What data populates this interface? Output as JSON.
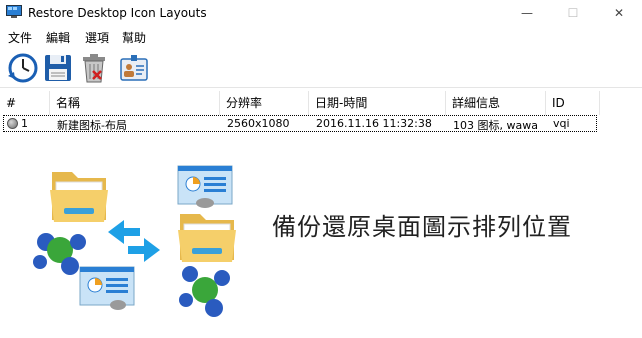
{
  "window": {
    "title": "Restore Desktop Icon Layouts",
    "minimize_glyph": "—",
    "maximize_glyph": "☐",
    "close_glyph": "✕"
  },
  "menu": [
    "文件",
    "編輯",
    "選項",
    "幫助"
  ],
  "toolbar": {
    "icons": [
      "clock-restore-icon",
      "save-disk-icon",
      "trash-delete-icon",
      "id-card-icon"
    ]
  },
  "list": {
    "columns": [
      "#",
      "名稱",
      "分辨率",
      "日期-時間",
      "詳細信息",
      "ID"
    ],
    "rows": [
      {
        "index": "1",
        "name": "新建图标-布局",
        "resolution": "2560x1080",
        "datetime": "2016.11.16 11:32:38",
        "details": "103 图标, wawa",
        "id": "vqi"
      }
    ]
  },
  "banner": {
    "text": "備份還原桌面圖示排列位置"
  },
  "colors": {
    "folder": "#f5cf6a",
    "arrow": "#1ea0e6",
    "card": "#c9e3f7",
    "ball_green": "#3aa63a",
    "ball_blue": "#2a5bbf"
  }
}
